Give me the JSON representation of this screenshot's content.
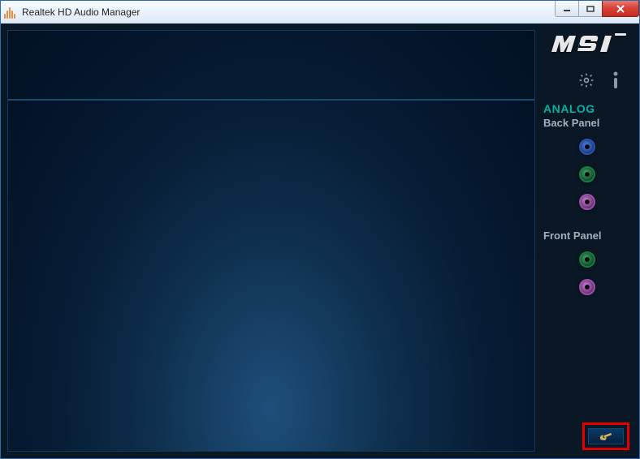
{
  "window": {
    "title": "Realtek HD Audio Manager"
  },
  "brand": {
    "name": "msi"
  },
  "sidebar": {
    "section": "ANALOG",
    "back_label": "Back Panel",
    "front_label": "Front Panel",
    "back_jacks": [
      {
        "color": "blue"
      },
      {
        "color": "green"
      },
      {
        "color": "pink"
      }
    ],
    "front_jacks": [
      {
        "color": "green"
      },
      {
        "color": "pink"
      }
    ]
  },
  "icons": {
    "settings": "gear-icon",
    "info": "info-icon",
    "connector": "wrench-icon"
  }
}
